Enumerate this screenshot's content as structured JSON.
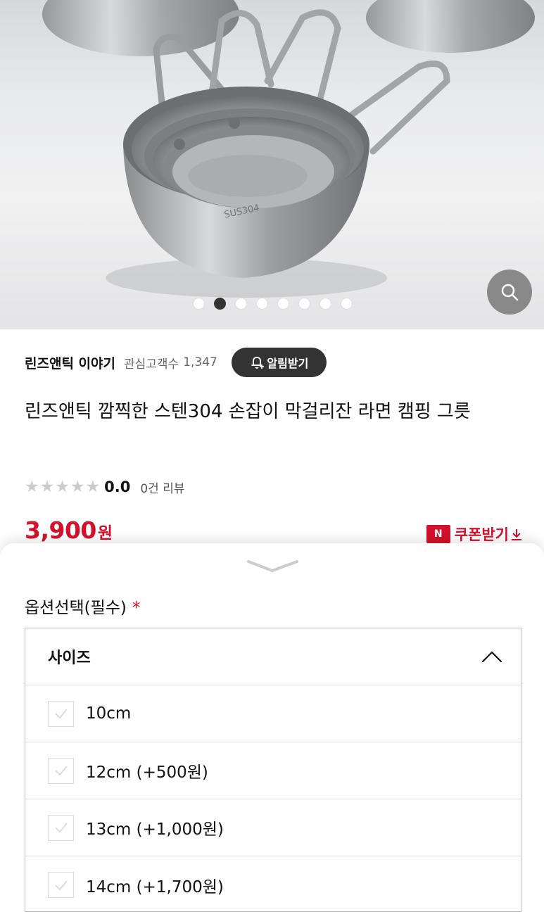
{
  "hero": {
    "engraving": "SUS304",
    "slides_total": 8,
    "active_slide": 2
  },
  "store": {
    "name": "린즈앤틱 이야기",
    "fans_label": "관심고객수",
    "fans_count": "1,347",
    "notify_label": "알림받기"
  },
  "product": {
    "title": "린즈앤틱 깜찍한 스텐304 손잡이 막걸리잔 라면 캠핑 그릇",
    "rating": "0.0",
    "rating_stars_filled": 0,
    "review_count": "0건 리뷰",
    "price": "3,900",
    "price_unit": "원",
    "coupon_badge": "N",
    "coupon_label": "쿠폰받기"
  },
  "option_sheet": {
    "label": "옵션선택(필수)",
    "required_mark": "*",
    "select_name": "사이즈",
    "options": [
      {
        "label": "10cm"
      },
      {
        "label": "12cm (+500원)"
      },
      {
        "label": "13cm (+1,000원)"
      },
      {
        "label": "14cm (+1,700원)"
      }
    ]
  },
  "colors": {
    "accent": "#d4102c",
    "dark_button": "#333333"
  },
  "icons": {
    "zoom": "magnifier-icon",
    "bell": "bell-plus-icon",
    "coupon_arrow": "download-arrow-icon",
    "handle": "chevron-down-icon",
    "collapse": "chevron-up-icon",
    "check": "check-icon"
  }
}
